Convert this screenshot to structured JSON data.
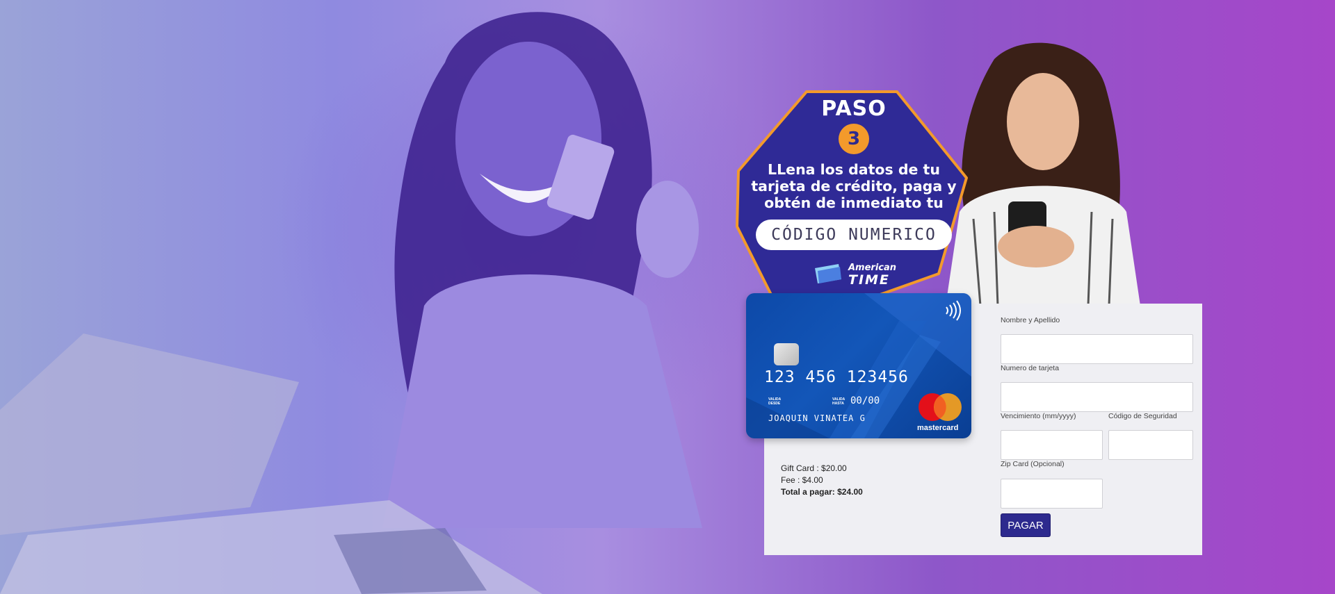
{
  "badge": {
    "title": "PASO",
    "step_number": "3",
    "text": "LLena los datos de tu tarjeta de crédito, paga y obtén de inmediato tu",
    "code_label": "CÓDIGO NUMERICO",
    "brand_line1": "American",
    "brand_line2": "TIME"
  },
  "card": {
    "number": "123 456 123456",
    "valid_from_label": "VALIDA DESDE",
    "valid_thru_label": "VALIDA HASTA",
    "expiry": "00/00",
    "holder": "JOAQUIN VINATEA G",
    "network": "mastercard"
  },
  "summary": {
    "gift_card": "Gift Card : $20.00",
    "fee": "Fee : $4.00",
    "total": "Total a pagar: $24.00"
  },
  "form": {
    "name_label": "Nombre y Apellido",
    "card_number_label": "Numero de tarjeta",
    "expiry_label": "Vencimiento (mm/yyyy)",
    "security_label": "Código de Seguridad",
    "zip_label": "Zip Card (Opcional)",
    "pay_button": "PAGAR"
  },
  "colors": {
    "accent": "#2d2a8e",
    "step_orange": "#f39a2b",
    "card_blue": "#1356b8"
  }
}
